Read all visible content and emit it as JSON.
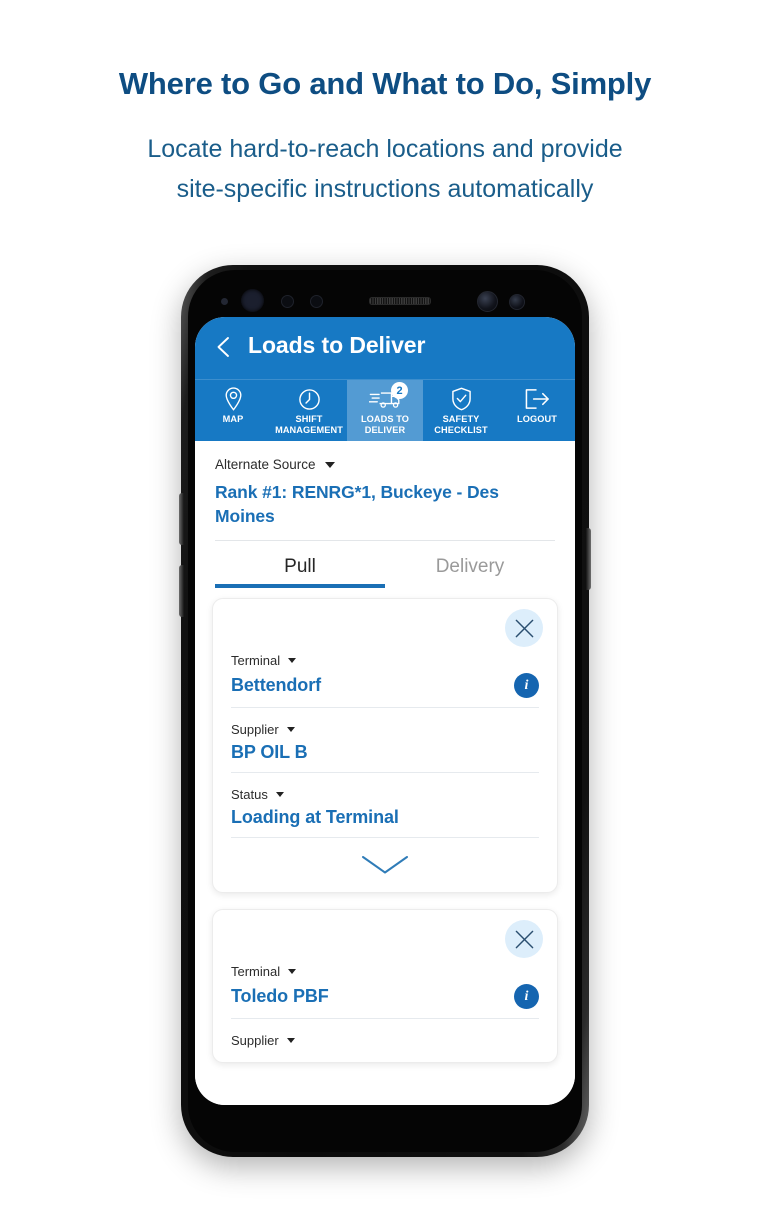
{
  "promo": {
    "title": "Where to Go and What to Do, Simply",
    "subtitle_line1": "Locate hard-to-reach locations and provide",
    "subtitle_line2": "site-specific instructions automatically",
    "title_color": "#0e4d82",
    "subtitle_color": "#1a5d8a"
  },
  "app": {
    "accent_blue": "#1779c4",
    "link_blue": "#1a6fb5",
    "info_blue": "#1565b0",
    "appbar": {
      "title": "Loads to Deliver",
      "back_icon": "chevron-left-icon"
    },
    "tabs": [
      {
        "label": "MAP",
        "icon": "map-pin-icon",
        "active": false,
        "badge": null
      },
      {
        "label": "SHIFT\nMANAGEMENT",
        "icon": "clock-gauge-icon",
        "active": false,
        "badge": null
      },
      {
        "label": "LOADS TO\nDELIVER",
        "icon": "truck-icon",
        "active": true,
        "badge": "2"
      },
      {
        "label": "SAFETY\nCHECKLIST",
        "icon": "shield-check-icon",
        "active": false,
        "badge": null
      },
      {
        "label": "LOGOUT",
        "icon": "logout-arrow-icon",
        "active": false,
        "badge": null
      }
    ],
    "source": {
      "label": "Alternate Source",
      "value": "Rank #1: RENRG*1, Buckeye - Des Moines",
      "caret_icon": "caret-down-icon"
    },
    "segmented": {
      "pull_label": "Pull",
      "delivery_label": "Delivery",
      "selected": "Pull"
    },
    "cards": [
      {
        "close_icon": "close-x-icon",
        "expand_icon": "chevron-down-icon",
        "expanded": true,
        "rows": [
          {
            "label": "Terminal",
            "value": "Bettendorf",
            "has_info": true,
            "info_icon": "info-circle-icon"
          },
          {
            "label": "Supplier",
            "value": "BP OIL B",
            "has_info": false,
            "info_icon": null
          },
          {
            "label": "Status",
            "value": "Loading at Terminal",
            "has_info": false,
            "info_icon": null
          }
        ]
      },
      {
        "close_icon": "close-x-icon",
        "expand_icon": null,
        "expanded": false,
        "rows": [
          {
            "label": "Terminal",
            "value": "Toledo PBF",
            "has_info": true,
            "info_icon": "info-circle-icon"
          },
          {
            "label": "Supplier",
            "value": "",
            "has_info": false,
            "info_icon": null
          }
        ]
      }
    ]
  }
}
